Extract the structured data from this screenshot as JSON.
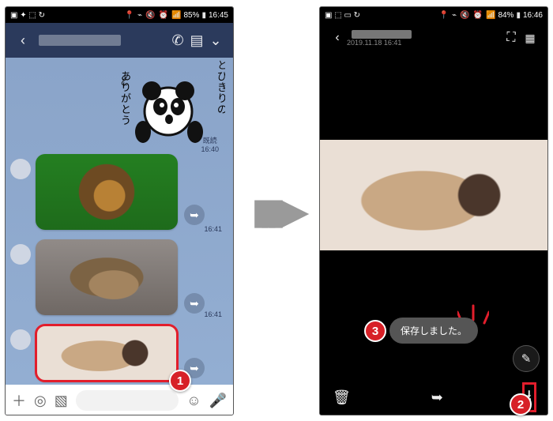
{
  "status_left": {
    "battery": "85%",
    "time": "16:45"
  },
  "status_right": {
    "battery": "84%",
    "time": "16:46"
  },
  "chat": {
    "read_label": "既読",
    "t1": "16:40",
    "t2": "16:41",
    "t3": "16:41",
    "sticker_text": "とびきりのありがとう"
  },
  "viewer": {
    "timestamp": "2019.11.18 16:41",
    "toast": "保存しました。"
  },
  "callouts": {
    "c1": "1",
    "c2": "2",
    "c3": "3"
  }
}
